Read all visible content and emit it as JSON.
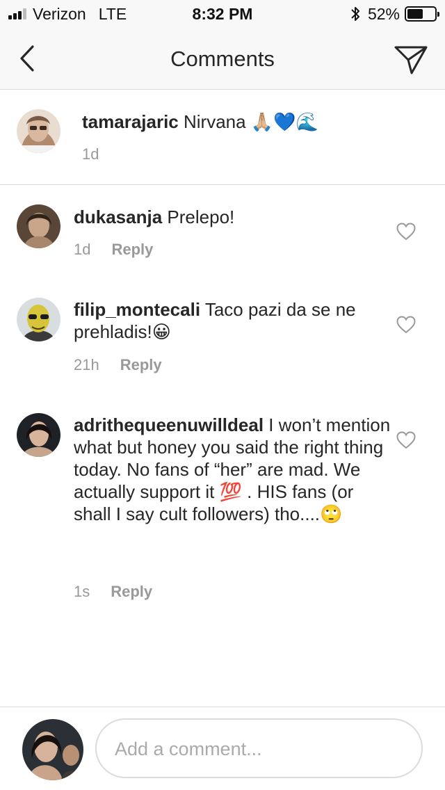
{
  "status_bar": {
    "carrier": "Verizon",
    "network": "LTE",
    "time": "8:32 PM",
    "battery": "52%",
    "battery_level": 0.52,
    "signal_bars": 3
  },
  "nav": {
    "title": "Comments",
    "back_icon": "chevron-left-icon",
    "send_icon": "paper-plane-icon"
  },
  "caption": {
    "username": "tamarajaric",
    "text": "Nirvana",
    "emoji": "🙏🏼💙🌊",
    "time": "1d"
  },
  "comments": [
    {
      "username": "dukasanja",
      "text": "Prelepo!",
      "time": "1d",
      "reply_label": "Reply"
    },
    {
      "username": "filip_montecali",
      "text": "Taco pazi da se ne prehladis!",
      "emoji": "😀",
      "time": "21h",
      "reply_label": "Reply"
    },
    {
      "username": "adrithequeenuwilldeal",
      "text_part1": "I won’t mention what but honey you said the right thing today. No fans of “her” are mad. We actually support it",
      "emoji1": "💯",
      "text_part2": ". HIS fans (or shall I say cult followers) tho....",
      "emoji2": "🙄",
      "time": "1s",
      "reply_label": "Reply"
    }
  ],
  "composer": {
    "placeholder": "Add a comment..."
  },
  "colors": {
    "text": "#262626",
    "muted": "#999999",
    "divider": "#dbdbdb",
    "bar_background": "#f8f8f8"
  }
}
